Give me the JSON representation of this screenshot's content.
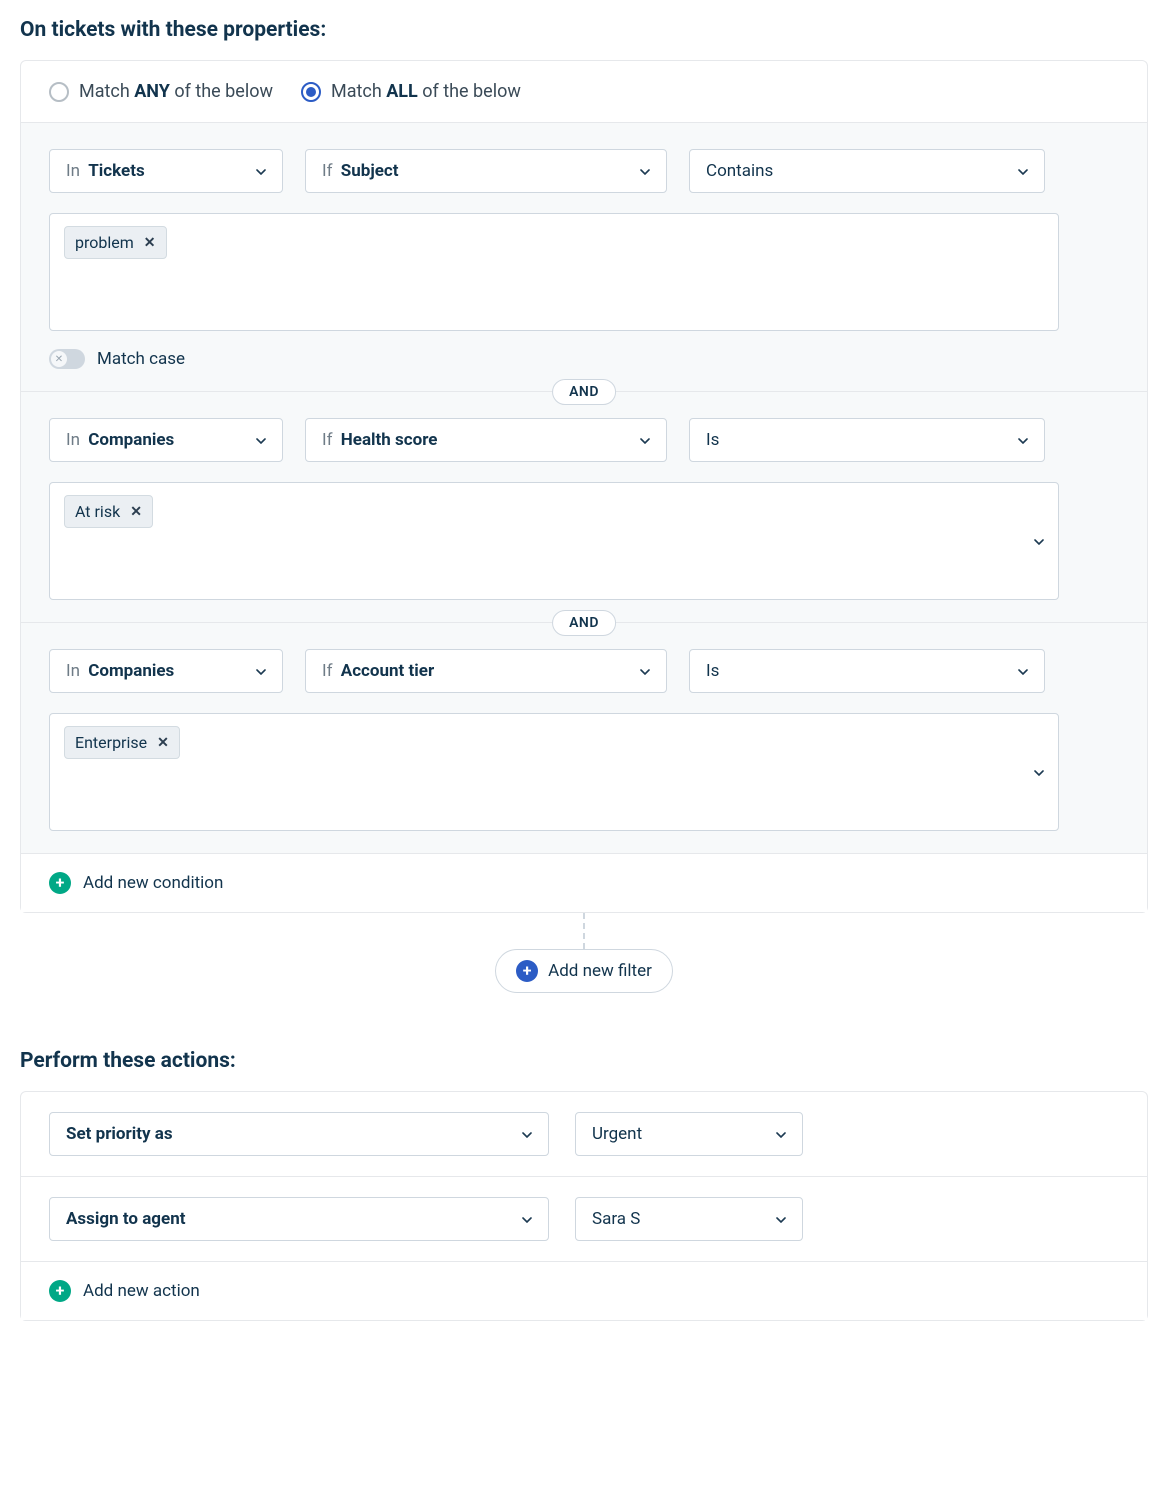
{
  "filterSection": {
    "title": "On tickets with these properties:",
    "matchAny": {
      "pre": "Match ",
      "bold": "ANY",
      "post": " of the below",
      "selected": false
    },
    "matchAll": {
      "pre": "Match ",
      "bold": "ALL",
      "post": " of the below",
      "selected": true
    },
    "joiner": "AND",
    "conditions": [
      {
        "scope": {
          "pre": "In ",
          "bold": "Tickets"
        },
        "field": {
          "pre": "If ",
          "bold": "Subject"
        },
        "operator": "Contains",
        "chips": [
          "problem"
        ],
        "hasDropdownOnChipbox": false,
        "showMatchCase": true,
        "matchCaseLabel": "Match case"
      },
      {
        "scope": {
          "pre": "In ",
          "bold": "Companies"
        },
        "field": {
          "pre": "If ",
          "bold": "Health score"
        },
        "operator": "Is",
        "chips": [
          "At risk"
        ],
        "hasDropdownOnChipbox": true,
        "showMatchCase": false
      },
      {
        "scope": {
          "pre": "In ",
          "bold": "Companies"
        },
        "field": {
          "pre": "If ",
          "bold": "Account tier"
        },
        "operator": "Is",
        "chips": [
          "Enterprise"
        ],
        "hasDropdownOnChipbox": true,
        "showMatchCase": false
      }
    ],
    "addCondition": "Add new condition",
    "addFilter": "Add new filter"
  },
  "actionsSection": {
    "title": "Perform these actions:",
    "actions": [
      {
        "action": "Set priority as",
        "value": "Urgent"
      },
      {
        "action": "Assign to agent",
        "value": "Sara S"
      }
    ],
    "addAction": "Add new action"
  }
}
